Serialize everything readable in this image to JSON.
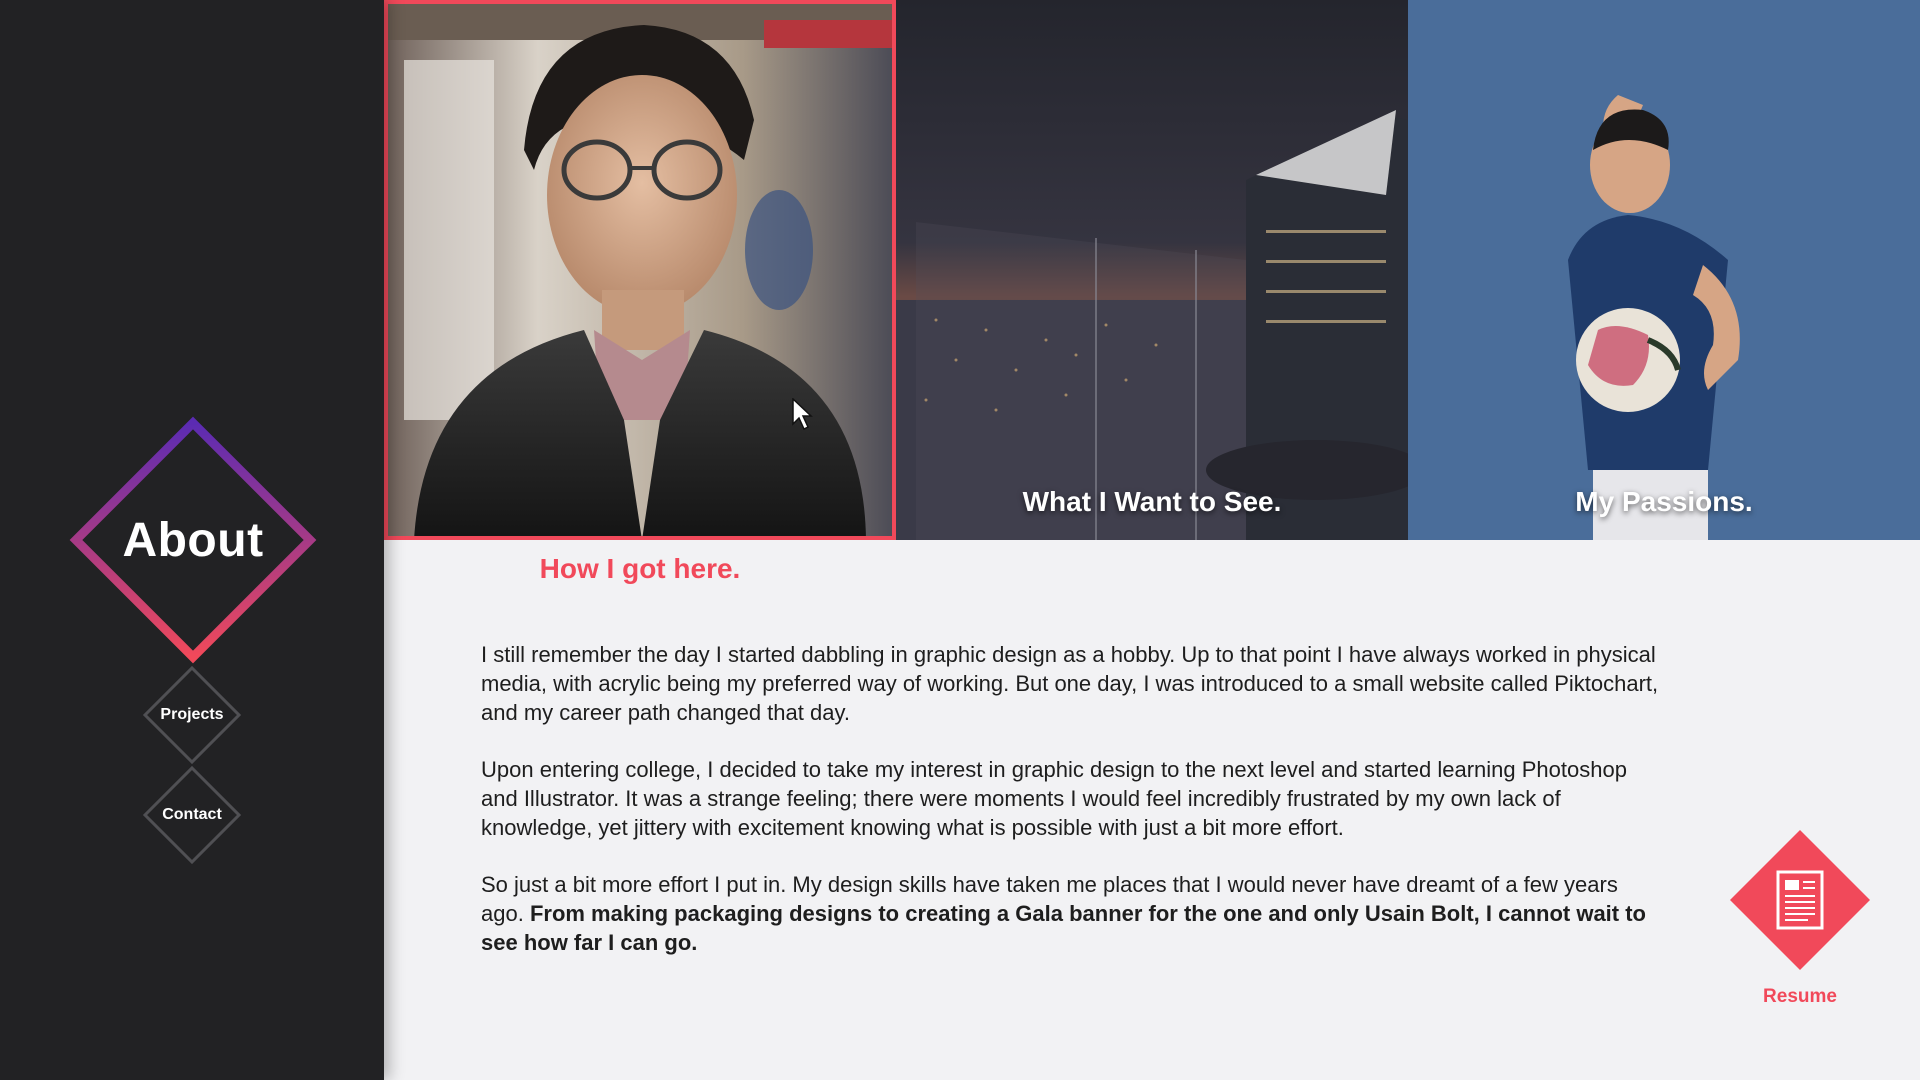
{
  "sidebar": {
    "active_label": "About",
    "nav": [
      {
        "label": "Projects"
      },
      {
        "label": "Contact"
      }
    ]
  },
  "tiles": [
    {
      "caption": "How I got here.",
      "active": true
    },
    {
      "caption": "What I Want to See."
    },
    {
      "caption": "My Passions."
    }
  ],
  "content": {
    "p1": "I still remember the day I started dabbling in graphic design as a hobby. Up to that point I have always worked in physical media, with acrylic being my preferred way of working. But one day, I was introduced to a small website called Piktochart, and my career path changed that day.",
    "p2": "Upon entering college, I decided to take my interest in graphic design to the next level and started learning Photoshop and Illustrator. It was a strange feeling; there were moments I would feel incredibly frustrated by my own lack of knowledge, yet jittery with excitement knowing what is possible with just a bit more effort.",
    "p3_plain": "So just a bit more effort I put in. My design skills have taken me places that I would never have dreamt of a few years ago. ",
    "p3_bold": "From making packaging designs to creating a Gala banner for the one and only Usain Bolt, I cannot wait to see how far I can go."
  },
  "resume": {
    "label": "Resume",
    "icon": "document-icon"
  },
  "colors": {
    "accent": "#f1495a",
    "gradient_top": "#5b2bb3",
    "gradient_bottom": "#f1495a",
    "sidebar": "#222224",
    "background": "#f2f2f4"
  }
}
